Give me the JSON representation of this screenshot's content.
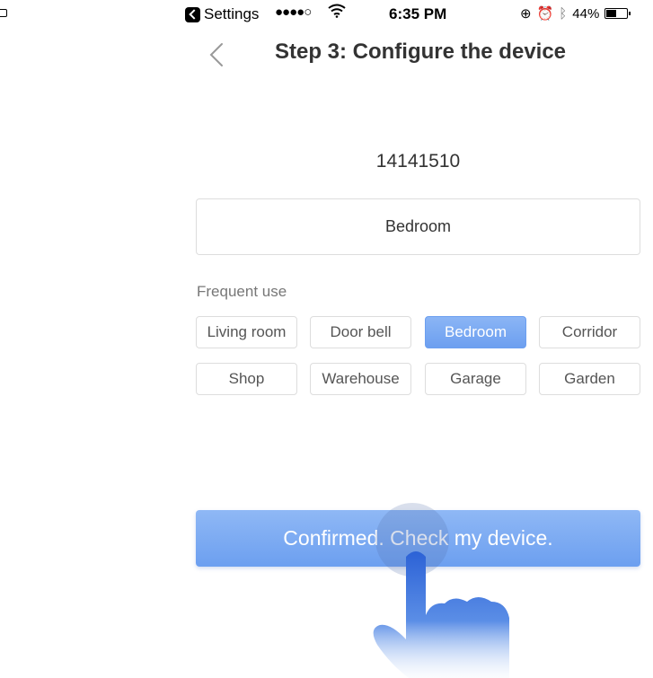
{
  "status_bar": {
    "back_app_label": "Settings",
    "signal": "●●●●○",
    "wifi_icon": "wifi-icon",
    "time": "6:35 PM",
    "battery_percent": "44%",
    "battery_level": 0.44
  },
  "nav": {
    "title": "Step 3: Configure the device",
    "back_icon": "chevron-left-icon"
  },
  "device": {
    "id": "14141510",
    "name_value": "Bedroom"
  },
  "frequent": {
    "label": "Frequent use",
    "options": [
      "Living room",
      "Door bell",
      "Bedroom",
      "Corridor",
      "Shop",
      "Warehouse",
      "Garage",
      "Garden"
    ],
    "selected": "Bedroom"
  },
  "confirm": {
    "label": "Confirmed. Check my device."
  },
  "colors": {
    "accent": "#6c9ff0",
    "accent_light": "#8fb8f5"
  }
}
